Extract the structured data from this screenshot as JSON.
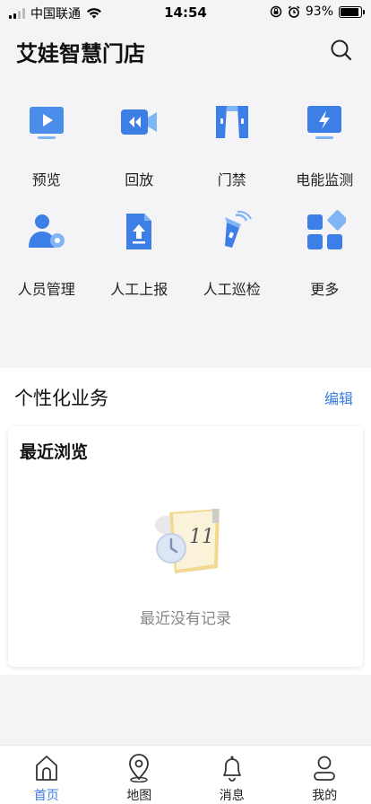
{
  "status_bar": {
    "carrier": "中国联通",
    "time": "14:54",
    "battery_percent": "93%",
    "battery_level": 0.93,
    "signal_bars_filled": 2,
    "icons": [
      "signal-icon",
      "wifi-icon",
      "rotation-lock-icon",
      "alarm-icon",
      "battery-icon"
    ]
  },
  "header": {
    "title": "艾娃智慧门店",
    "search_icon": "search-icon"
  },
  "grid": {
    "items": [
      {
        "label": "预览",
        "icon": "preview-monitor-icon"
      },
      {
        "label": "回放",
        "icon": "playback-camera-icon"
      },
      {
        "label": "门禁",
        "icon": "access-control-door-icon"
      },
      {
        "label": "电能监测",
        "icon": "power-monitor-icon"
      },
      {
        "label": "人员管理",
        "icon": "personnel-management-icon"
      },
      {
        "label": "人工上报",
        "icon": "manual-report-icon"
      },
      {
        "label": "人工巡检",
        "icon": "manual-inspection-flashlight-icon"
      },
      {
        "label": "更多",
        "icon": "more-apps-icon"
      }
    ]
  },
  "personalized": {
    "title": "个性化业务",
    "edit_label": "编辑",
    "recent": {
      "title": "最近浏览",
      "empty_text": "最近没有记录",
      "empty_icon": "calendar-clock-icon",
      "calendar_number": "11"
    }
  },
  "tabbar": {
    "active": 0,
    "tabs": [
      {
        "label": "首页",
        "icon": "home-icon"
      },
      {
        "label": "地图",
        "icon": "map-pin-icon"
      },
      {
        "label": "消息",
        "icon": "bell-icon"
      },
      {
        "label": "我的",
        "icon": "user-icon"
      }
    ]
  },
  "colors": {
    "accent": "#3a7ce0",
    "icon_blue": "#3d7fe6",
    "icon_light_blue": "#7fb4f5",
    "background": "#f4f4f6"
  }
}
